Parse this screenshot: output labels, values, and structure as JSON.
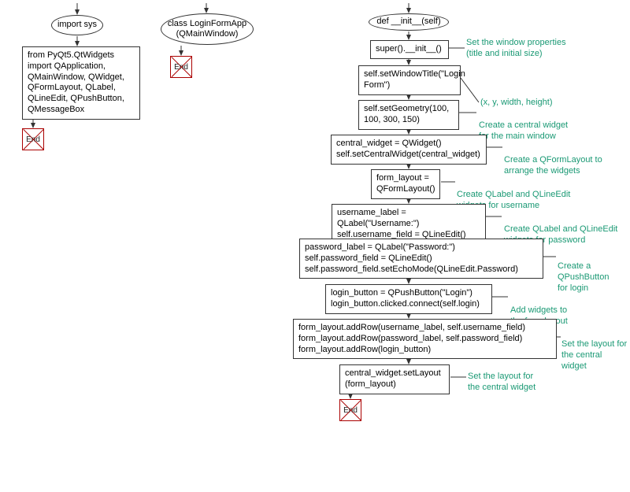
{
  "col1": {
    "start": "import sys",
    "box1": "from PyQt5.QtWidgets import QApplication, QMainWindow, QWidget, QFormLayout, QLabel, QLineEdit, QPushButton, QMessageBox",
    "end": "End"
  },
  "col2": {
    "start": "class LoginFormApp\n(QMainWindow)",
    "end": "End"
  },
  "col3": {
    "start": "def __init__(self)",
    "b1": "super().__init__()",
    "c1": "Set the window properties\n(title and initial size)",
    "b2": "self.setWindowTitle(\"Login\nForm\")",
    "c2": "(x, y, width, height)",
    "b3": "self.setGeometry(100,\n100, 300, 150)",
    "c3": "Create a central widget\nfor the main window",
    "b4": "central_widget = QWidget()\nself.setCentralWidget(central_widget)",
    "c4": "Create a QFormLayout to\narrange the widgets",
    "b5": "form_layout =\nQFormLayout()",
    "c5": "Create QLabel and QLineEdit\nwidgets for username",
    "b6": "username_label = QLabel(\"Username:\")\nself.username_field = QLineEdit()",
    "c6": "Create QLabel and QLineEdit\nwidgets for password",
    "b7": "password_label = QLabel(\"Password:\")\nself.password_field = QLineEdit()\nself.password_field.setEchoMode(QLineEdit.Password)",
    "c7": "Create a QPushButton\nfor login",
    "b8": "login_button = QPushButton(\"Login\")\nlogin_button.clicked.connect(self.login)",
    "c8": "Add widgets to\nthe form layout",
    "b9": "form_layout.addRow(username_label, self.username_field)\nform_layout.addRow(password_label, self.password_field)\nform_layout.addRow(login_button)",
    "c9": "Set the layout for\nthe central widget",
    "b10": "central_widget.setLayout\n(form_layout)",
    "end": "End"
  }
}
